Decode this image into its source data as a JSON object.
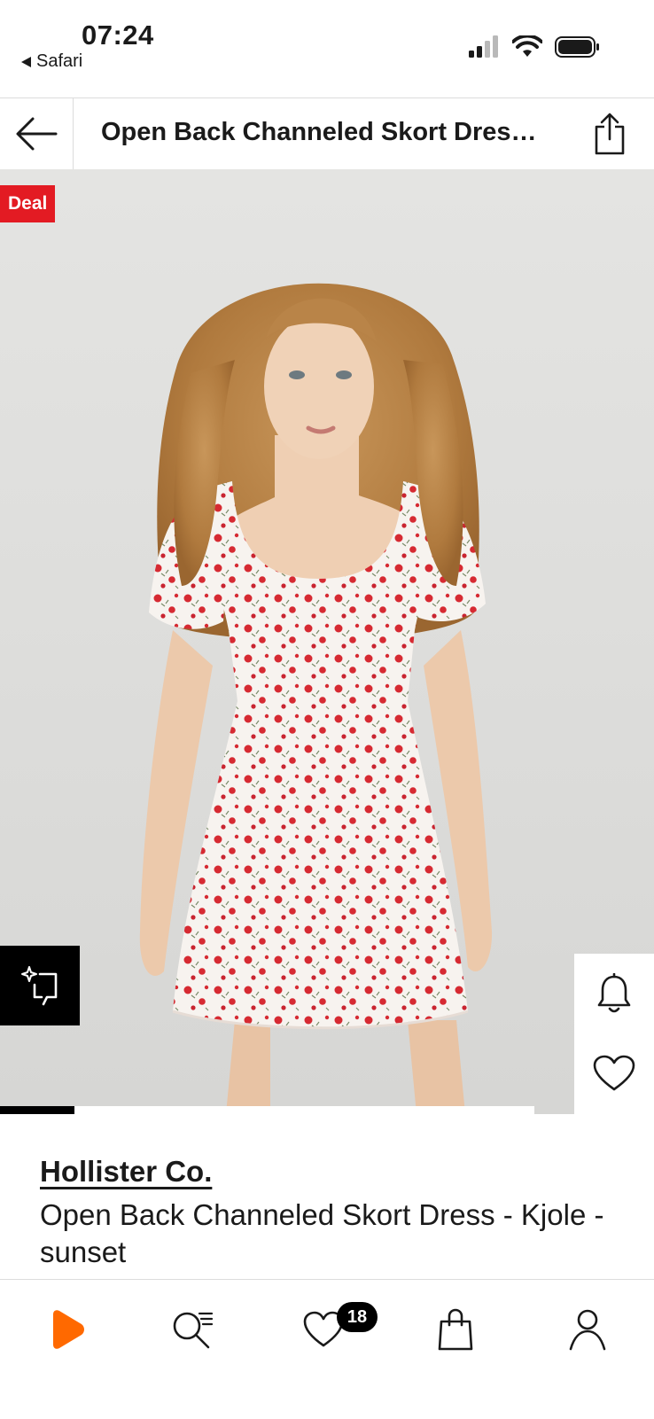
{
  "status_bar": {
    "time": "07:24",
    "back_app": "Safari"
  },
  "header": {
    "title": "Open Back Channeled Skort Dress - Kjole - sunset"
  },
  "gallery": {
    "badge": "Deal",
    "progress_fraction": 0.14
  },
  "product": {
    "brand": "Hollister Co.",
    "name": "Open Back Channeled Skort Dress - Kjole - sunset"
  },
  "bottom_nav": {
    "items": [
      {
        "icon": "play-logo-icon"
      },
      {
        "icon": "search-icon"
      },
      {
        "icon": "heart-icon"
      },
      {
        "icon": "bag-icon"
      },
      {
        "icon": "person-icon"
      }
    ],
    "wishlist_count": "18"
  },
  "colors": {
    "accent": "#ff6900",
    "deal": "#e31b23",
    "dress_print": "#d62a32"
  }
}
